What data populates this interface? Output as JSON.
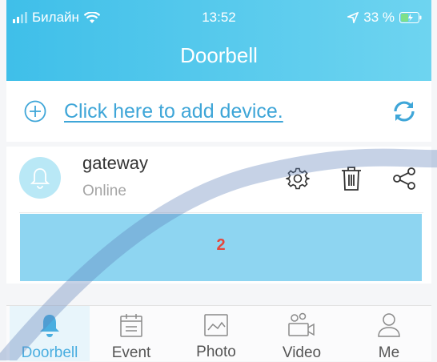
{
  "status_bar": {
    "carrier": "Билайн",
    "time": "13:52",
    "battery": "33 %",
    "icons": [
      "signal-icon",
      "wifi-icon",
      "location-icon",
      "battery-icon"
    ]
  },
  "header": {
    "title": "Doorbell"
  },
  "add_device": {
    "label": "Click here to add device."
  },
  "device": {
    "name": "gateway",
    "status": "Online",
    "preview_label": "2"
  },
  "tabs": [
    {
      "label": "Doorbell",
      "icon": "bell-icon",
      "active": true
    },
    {
      "label": "Event",
      "icon": "calendar-icon",
      "active": false
    },
    {
      "label": "Photo",
      "icon": "photo-icon",
      "active": false
    },
    {
      "label": "Video",
      "icon": "video-icon",
      "active": false
    },
    {
      "label": "Me",
      "icon": "person-icon",
      "active": false
    }
  ],
  "colors": {
    "header": "#3fbfe9",
    "accent": "#3fa6d8",
    "preview": "#8ed5f1",
    "preview_label": "#e5473d"
  }
}
